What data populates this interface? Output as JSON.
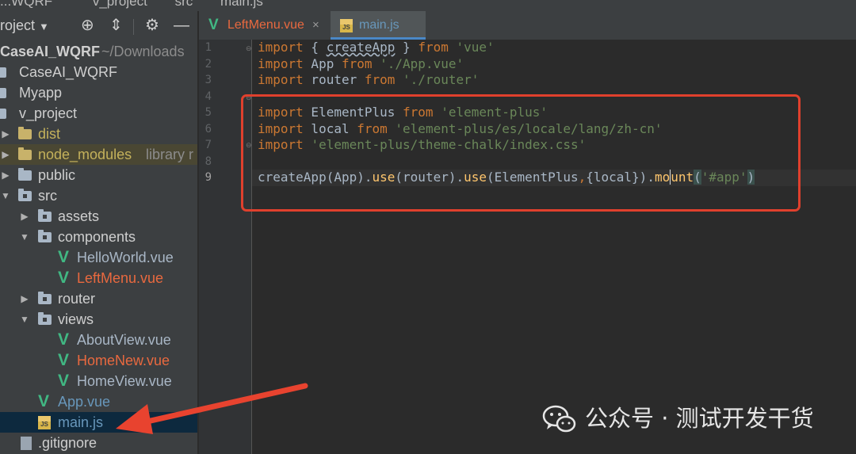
{
  "breadcrumb": [
    "...WQRF",
    "v_project",
    "src",
    "main.js"
  ],
  "sidebar": {
    "title": "roject",
    "tools": {
      "locate": "⊕",
      "collapse": "⇕",
      "settings": "⚙",
      "hide": "—"
    },
    "tree": [
      {
        "name": "CaseAI_WQRF",
        "suffix": " ~/Downloads"
      },
      {
        "name": "CaseAI_WQRF"
      },
      {
        "name": "Myapp"
      },
      {
        "name": "v_project"
      },
      {
        "name": "dist"
      },
      {
        "name": "node_modules",
        "suffix": "library r"
      },
      {
        "name": "public"
      },
      {
        "name": "src"
      },
      {
        "name": "assets"
      },
      {
        "name": "components"
      },
      {
        "name": "HelloWorld.vue"
      },
      {
        "name": "LeftMenu.vue"
      },
      {
        "name": "router"
      },
      {
        "name": "views"
      },
      {
        "name": "AboutView.vue"
      },
      {
        "name": "HomeNew.vue"
      },
      {
        "name": "HomeView.vue"
      },
      {
        "name": "App.vue"
      },
      {
        "name": "main.js"
      },
      {
        "name": ".gitignore"
      }
    ]
  },
  "tabs": [
    {
      "label": "LeftMenu.vue",
      "close": "×"
    },
    {
      "label": "main.js",
      "js_icon": "JS"
    }
  ],
  "editor": {
    "line_numbers": [
      "1",
      "2",
      "3",
      "4",
      "5",
      "6",
      "7",
      "8",
      "9"
    ],
    "lines": [
      {
        "t1": "import",
        "t2": " { ",
        "t3": "createApp",
        "t4": " } ",
        "t5": "from",
        "t6": " ",
        "t7": "'vue'"
      },
      {
        "t1": "import",
        "t2": " App ",
        "t3": "from",
        "t4": " ",
        "t5": "'./App.vue'"
      },
      {
        "t1": "import",
        "t2": " router ",
        "t3": "from",
        "t4": " ",
        "t5": "'./router'"
      },
      {},
      {
        "t1": "import",
        "t2": " ElementPlus ",
        "t3": "from",
        "t4": " ",
        "t5": "'element-plus'"
      },
      {
        "t1": "import",
        "t2": " local ",
        "t3": "from",
        "t4": " ",
        "t5": "'element-plus/es/locale/lang/zh-cn'"
      },
      {
        "t1": "import",
        "t2": " ",
        "t3": "'element-plus/theme-chalk/index.css'"
      },
      {},
      {
        "t1": "createApp(App).",
        "t2": "use",
        "t3": "(router).",
        "t4": "use",
        "t5": "(ElementPlus",
        "t6": ",",
        "t7": "{local}).",
        "t8": "mo",
        "t9": "unt",
        "t10": "(",
        "t11": "'#app'",
        "t12": ")"
      }
    ]
  },
  "watermark": {
    "text": "公众号 · 测试开发干货"
  },
  "colors": {
    "highlight_box": "#e0402d",
    "arrow": "#e8432f",
    "vue": "#41b883",
    "keyword": "#cc7832",
    "string": "#6a8759"
  }
}
